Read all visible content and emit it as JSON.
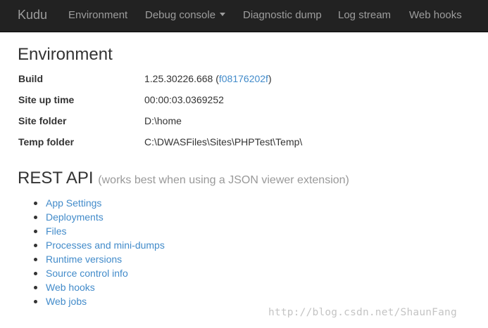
{
  "navbar": {
    "brand": "Kudu",
    "items": [
      {
        "label": "Environment"
      },
      {
        "label": "Debug console"
      },
      {
        "label": "Diagnostic dump"
      },
      {
        "label": "Log stream"
      },
      {
        "label": "Web hooks"
      }
    ]
  },
  "environment": {
    "title": "Environment",
    "rows": [
      {
        "label": "Build",
        "value_prefix": "1.25.30226.668 (",
        "value_link": "f08176202f",
        "value_suffix": ")"
      },
      {
        "label": "Site up time",
        "value": "00:00:03.0369252"
      },
      {
        "label": "Site folder",
        "value": "D:\\home"
      },
      {
        "label": "Temp folder",
        "value": "C:\\DWASFiles\\Sites\\PHPTest\\Temp\\"
      }
    ]
  },
  "rest_api": {
    "title": "REST API",
    "subtitle": "(works best when using a JSON viewer extension)",
    "links": [
      "App Settings",
      "Deployments",
      "Files",
      "Processes and mini-dumps",
      "Runtime versions",
      "Source control info",
      "Web hooks",
      "Web jobs"
    ]
  },
  "watermark": "http://blog.csdn.net/ShaunFang",
  "colors": {
    "navbar_bg": "#222222",
    "nav_text": "#9d9d9d",
    "link": "#428bca",
    "text": "#333333",
    "muted": "#999999"
  }
}
